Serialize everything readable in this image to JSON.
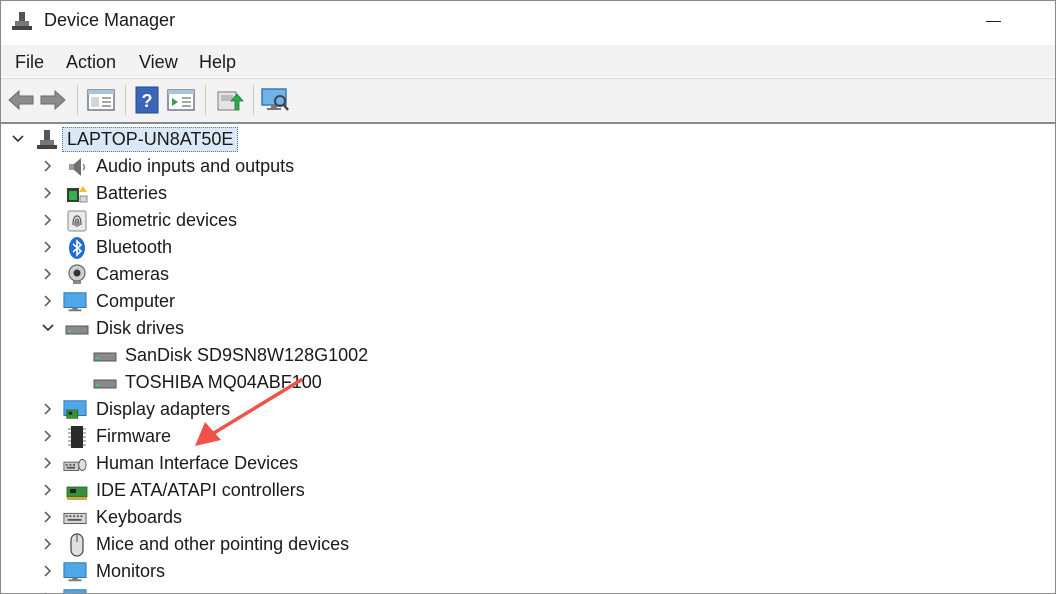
{
  "window": {
    "title": "Device Manager"
  },
  "menu": [
    "File",
    "Action",
    "View",
    "Help"
  ],
  "toolbar": {
    "buttons": [
      "back-icon",
      "forward-icon",
      "properties-icon",
      "help-icon",
      "action-pane-icon",
      "update-driver-icon",
      "scan-hardware-icon"
    ]
  },
  "tree": {
    "root": "LAPTOP-UN8AT50E",
    "categories": [
      "Audio inputs and outputs",
      "Batteries",
      "Biometric devices",
      "Bluetooth",
      "Cameras",
      "Computer",
      "Disk drives",
      "Display adapters",
      "Firmware",
      "Human Interface Devices",
      "IDE ATA/ATAPI controllers",
      "Keyboards",
      "Mice and other pointing devices",
      "Monitors"
    ],
    "disk_drives_children": [
      "SanDisk SD9SN8W128G1002",
      "TOSHIBA MQ04ABF100"
    ]
  },
  "colors": {
    "annotation_arrow": "#f0524a",
    "selection_bg": "#dbe9f7"
  }
}
